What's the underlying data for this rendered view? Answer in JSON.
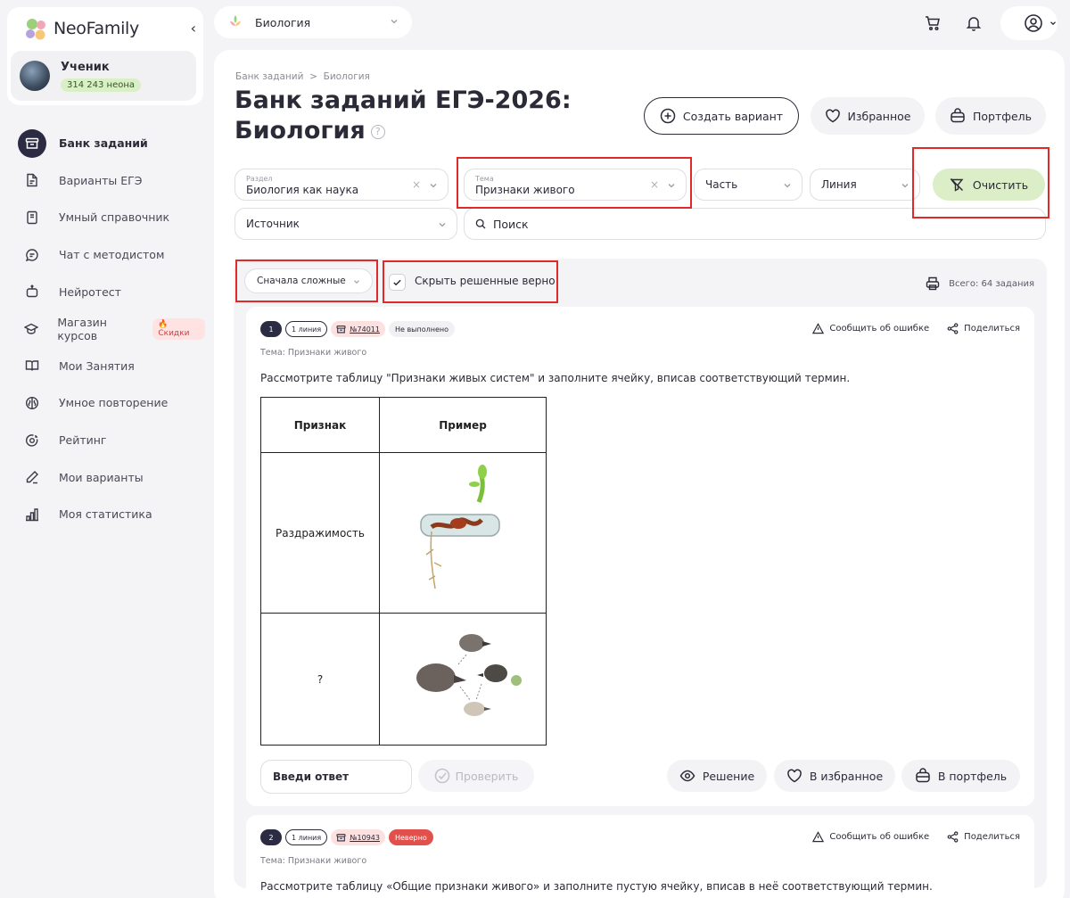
{
  "app": {
    "name": "NeoFamily"
  },
  "user": {
    "name": "Ученик",
    "neon": "314 243 неона"
  },
  "nav": [
    {
      "label": "Банк заданий",
      "icon": "archive-icon",
      "active": true
    },
    {
      "label": "Варианты ЕГЭ",
      "icon": "document-icon"
    },
    {
      "label": "Умный справочник",
      "icon": "book-icon"
    },
    {
      "label": "Чат с методистом",
      "icon": "chat-icon"
    },
    {
      "label": "Нейротест",
      "icon": "robot-icon"
    },
    {
      "label": "Магазин курсов",
      "icon": "graduation-cap-icon",
      "badge": "Скидки"
    },
    {
      "label": "Мои Занятия",
      "icon": "open-book-icon"
    },
    {
      "label": "Умное повторение",
      "icon": "brain-icon"
    },
    {
      "label": "Рейтинг",
      "icon": "target-icon"
    },
    {
      "label": "Мои варианты",
      "icon": "pencil-icon"
    },
    {
      "label": "Моя статистика",
      "icon": "bar-chart-icon"
    }
  ],
  "topbar": {
    "subject": "Биология"
  },
  "breadcrumb": {
    "root": "Банк заданий",
    "separator": ">",
    "current": "Биология"
  },
  "page": {
    "title_line1": "Банк заданий ЕГЭ-2026:",
    "title_line2": "Биология",
    "help": "?"
  },
  "actions": {
    "create": "Создать вариант",
    "favorites": "Избранное",
    "portfolio": "Портфель"
  },
  "filters": {
    "section": {
      "label": "Раздел",
      "value": "Биология как наука"
    },
    "topic": {
      "label": "Тема",
      "value": "Признаки живого"
    },
    "part": {
      "value": "Часть"
    },
    "line": {
      "value": "Линия"
    },
    "clear": "Очистить",
    "source": {
      "value": "Источник"
    },
    "search": {
      "placeholder": "Поиск"
    }
  },
  "list": {
    "sort": "Сначала сложные",
    "hide_solved": "Скрыть решенные верно",
    "hide_solved_checked": true,
    "total": "Всего: 64 задания"
  },
  "tasks": [
    {
      "num": "1",
      "line": "1 линия",
      "id": "№74011",
      "status": "Не выполнено",
      "report": "Сообщить об ошибке",
      "share": "Поделиться",
      "topic": "Тема: Признаки живого",
      "question": "Рассмотрите таблицу \"Признаки живых систем\" и заполните ячейку, вписав соответствующий термин.",
      "table": {
        "headers": [
          "Признак",
          "Пример"
        ],
        "rows": [
          "Раздражимость",
          "?"
        ]
      },
      "answer_placeholder": "Введи ответ",
      "check": "Проверить",
      "solution": "Решение",
      "to_favorites": "В избранное",
      "to_portfolio": "В портфель"
    },
    {
      "num": "2",
      "line": "1 линия",
      "id": "№10943",
      "status": "Неверно",
      "report": "Сообщить об ошибке",
      "share": "Поделиться",
      "topic": "Тема: Признаки живого",
      "question": "Рассмотрите таблицу «Общие признаки живого» и заполните пустую ячейку, вписав в неё соответствующий термин."
    }
  ],
  "colors": {
    "accent_dark": "#2b2b44",
    "clear_green": "#dbeec8",
    "neon_badge": "#d9efc6",
    "wrong_red": "#e2504c",
    "highlight": "#e02a2a"
  }
}
